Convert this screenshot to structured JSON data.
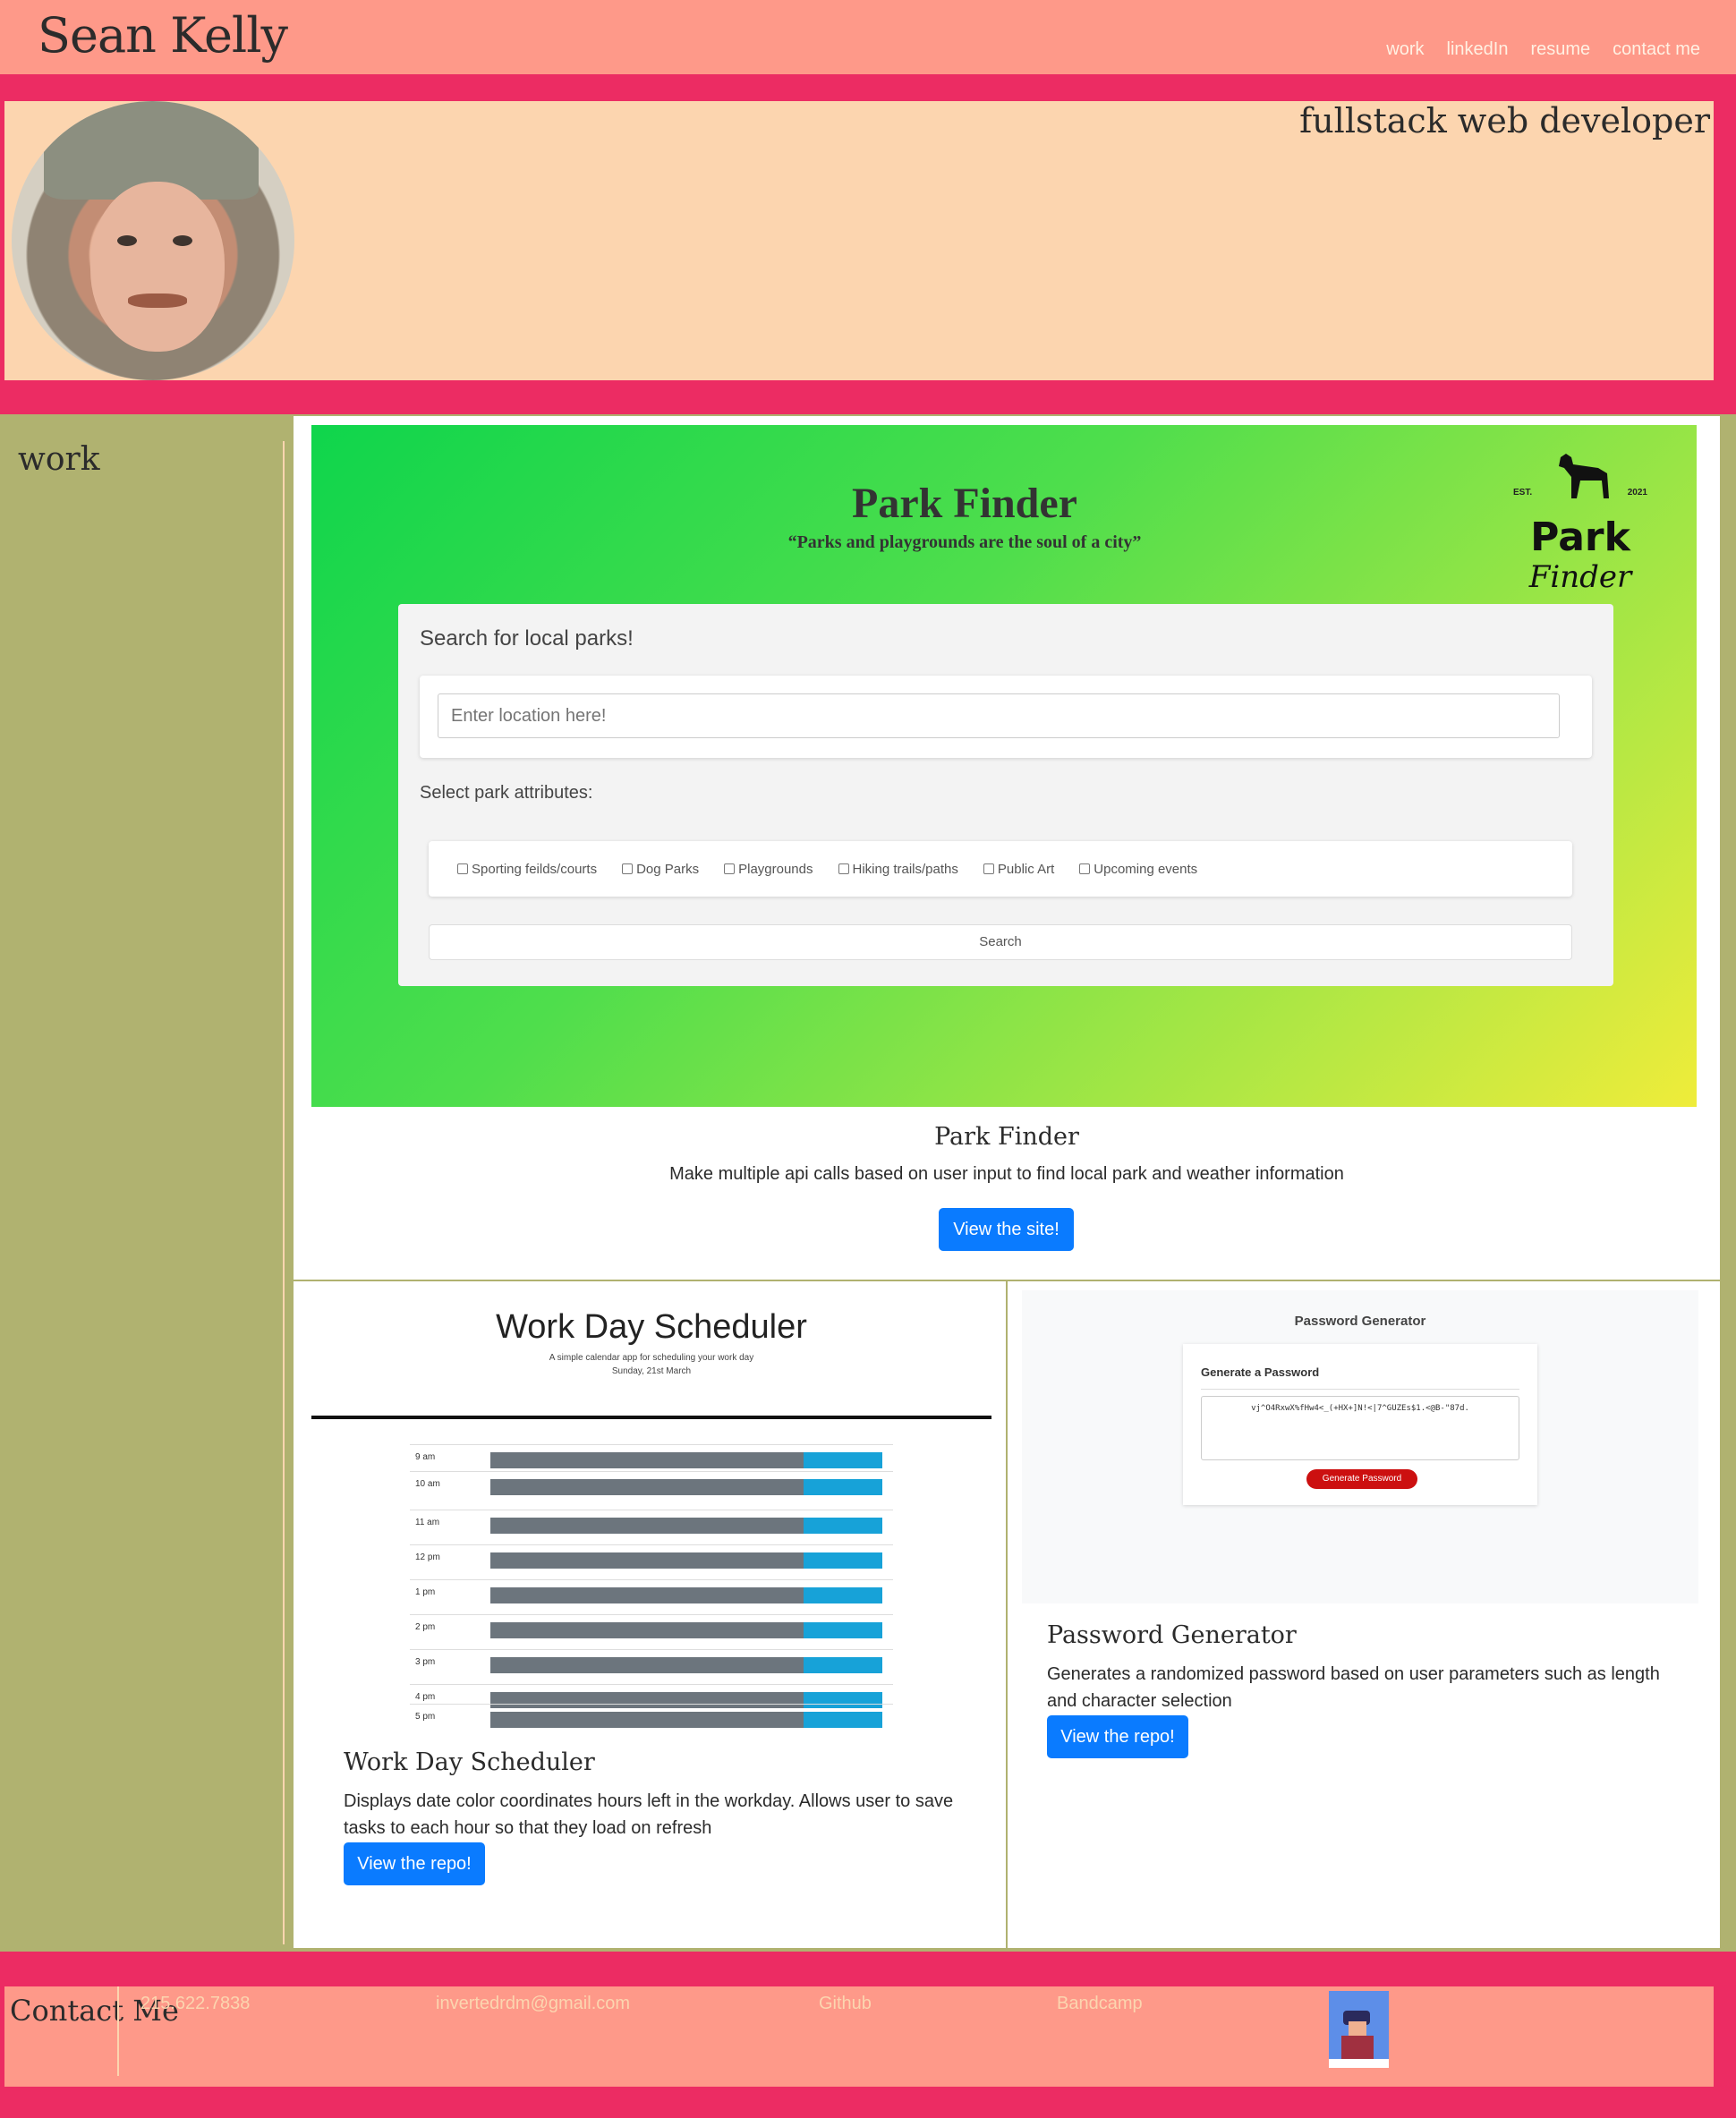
{
  "header": {
    "name": "Sean Kelly",
    "nav": [
      "work",
      "linkedIn",
      "resume",
      "contact me"
    ],
    "tagline": "fullstack web developer"
  },
  "main": {
    "section_title": "work",
    "projects": [
      {
        "title": "Park Finder",
        "description": "Make multiple api calls based on user input to find local park and weather information",
        "button": "View the site!",
        "screenshot": {
          "heading": "Park Finder",
          "quote": "“Parks and playgrounds are the soul of a city”",
          "logo_est": "EST.",
          "logo_year": "2021",
          "logo_word1": "Park",
          "logo_word2": "Finder",
          "search_heading": "Search for local parks!",
          "location_placeholder": "Enter location here!",
          "attributes_label": "Select park attributes:",
          "attributes": [
            "Sporting feilds/courts",
            "Dog Parks",
            "Playgrounds",
            "Hiking trails/paths",
            "Public Art",
            "Upcoming events"
          ],
          "search_button": "Search"
        }
      },
      {
        "title": "Work Day Scheduler",
        "description": "Displays date color coordinates hours left in the workday. Allows user to save tasks to each hour so that they load on refresh",
        "button": "View the repo!",
        "screenshot": {
          "heading": "Work Day Scheduler",
          "subheading": "A simple calendar app for scheduling your work day",
          "date": "Sunday, 21st March",
          "hours": [
            "9 am",
            "10 am",
            "11 am",
            "12 pm",
            "1 pm",
            "2 pm",
            "3 pm",
            "4 pm",
            "5 pm"
          ]
        }
      },
      {
        "title": "Password Generator",
        "description": "Generates a randomized password based on user parameters such as length and character selection",
        "button": "View the repo!",
        "screenshot": {
          "heading": "Password Generator",
          "card_title": "Generate a Password",
          "password": "vj^O4RxwX%fHw4<_(+HX+]N!<|7^GUZEs$1.<@B-\"87d.",
          "button": "Generate Password"
        }
      }
    ]
  },
  "footer": {
    "title": "Contact Me",
    "phone": "215.622.7838",
    "email": "invertedrdm@gmail.com",
    "github": "Github",
    "bandcamp": "Bandcamp"
  },
  "colors": {
    "page_bg": "#ec2c63",
    "header_bg": "#fe9989",
    "hero_bg": "#fcd5af",
    "main_bg": "#b0b270",
    "button": "#0a7bff"
  }
}
